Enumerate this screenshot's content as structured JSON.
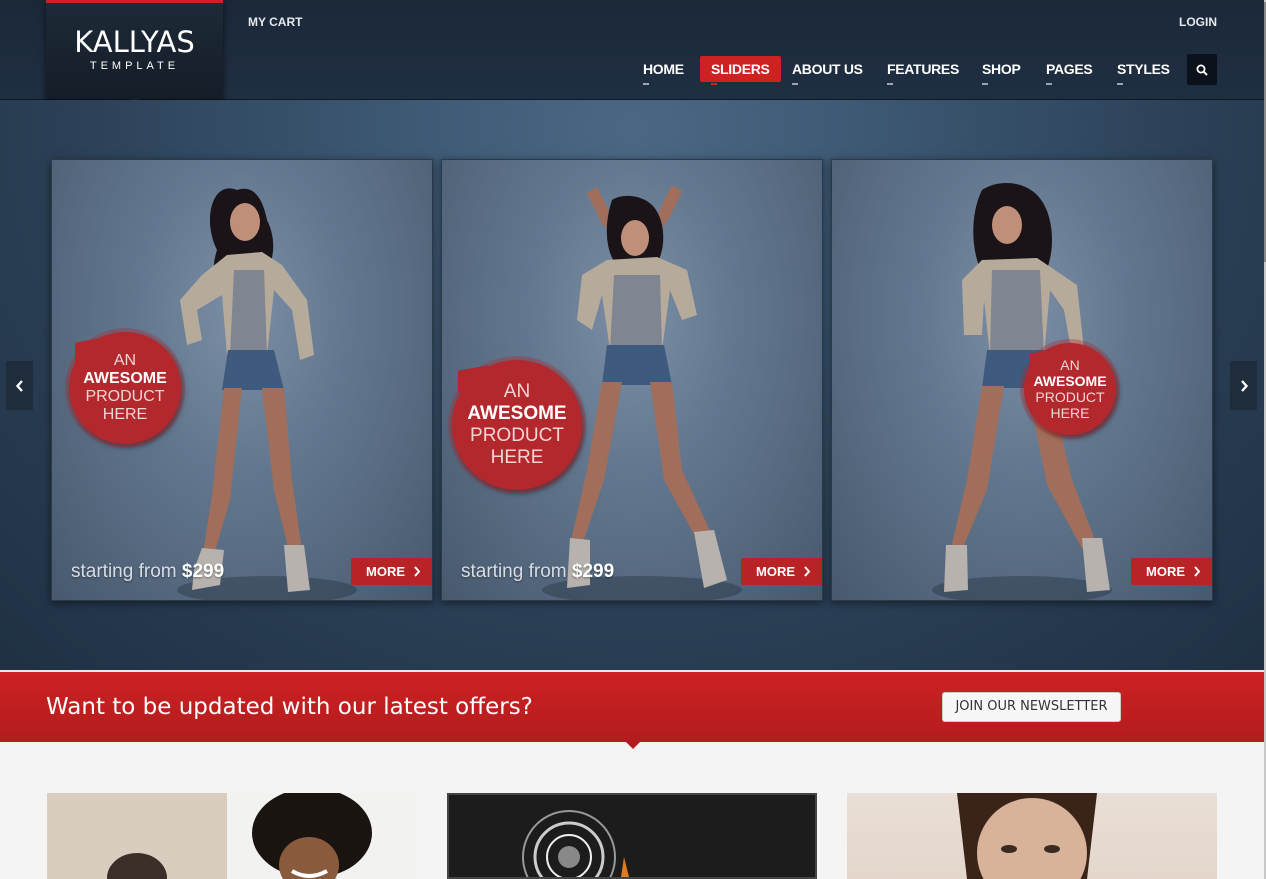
{
  "header": {
    "logo_main": "KALLYAS",
    "logo_sub": "TEMPLATE",
    "my_cart": "MY CART",
    "login": "LOGIN",
    "nav": [
      "HOME",
      "SLIDERS",
      "ABOUT US",
      "FEATURES",
      "SHOP",
      "PAGES",
      "STYLES"
    ],
    "active_nav": "SLIDERS",
    "search_icon": "search-icon"
  },
  "slider": {
    "cards": [
      {
        "badge_line1": "AN",
        "badge_line2": "AWESOME",
        "badge_line3": "PRODUCT",
        "badge_line4": "HERE",
        "price_prefix": "starting from",
        "price": "$299",
        "more_label": "MORE"
      },
      {
        "badge_line1": "AN",
        "badge_line2": "AWESOME",
        "badge_line3": "PRODUCT",
        "badge_line4": "HERE",
        "price_prefix": "starting from",
        "price": "$299",
        "more_label": "MORE"
      },
      {
        "badge_line1": "AN",
        "badge_line2": "AWESOME",
        "badge_line3": "PRODUCT",
        "badge_line4": "HERE",
        "more_label": "MORE"
      }
    ],
    "prev_icon": "chevron-left-icon",
    "next_icon": "chevron-right-icon"
  },
  "newsletter": {
    "text": "Want to be updated with our latest offers?",
    "button": "JOIN OUR NEWSLETTER"
  },
  "colors": {
    "accent": "#cd2122",
    "header_bg": "#1b2838",
    "slider_bg": "#2a3f55"
  }
}
